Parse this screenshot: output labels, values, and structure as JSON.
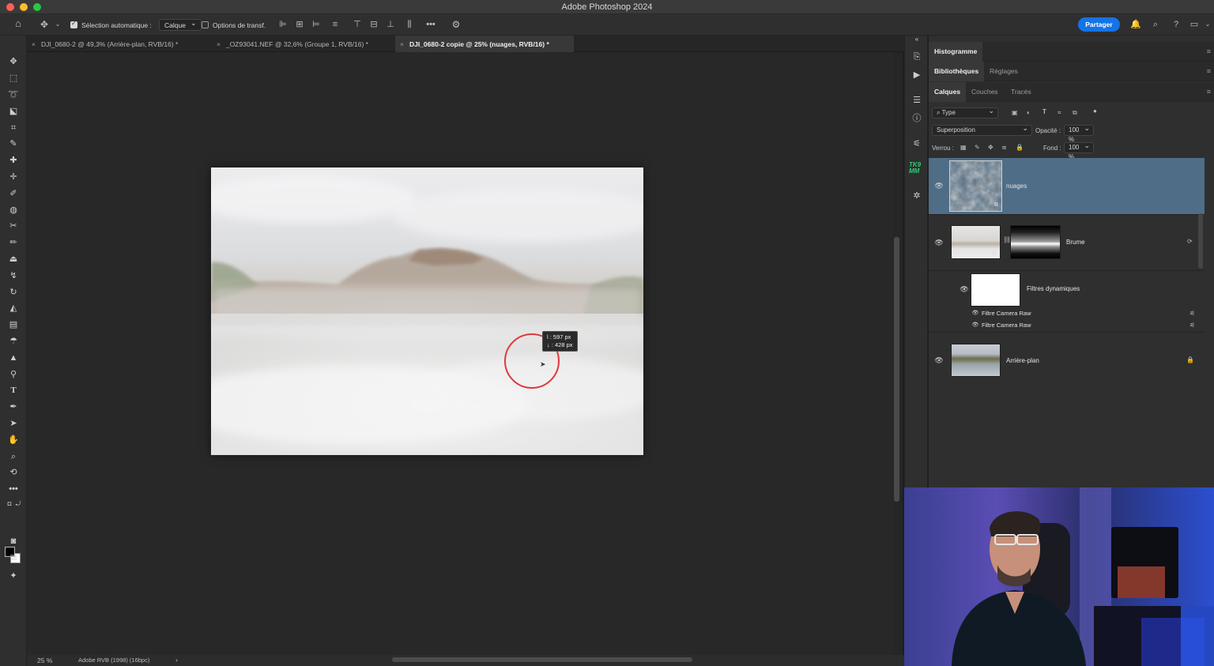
{
  "window": {
    "title": "Adobe Photoshop 2024"
  },
  "options_bar": {
    "auto_select_label": "Sélection automatique :",
    "auto_select_value": "Calque",
    "transform_options_label": "Options de transf.",
    "share_label": "Partager"
  },
  "doc_tabs": [
    {
      "label": "DJI_0680-2 @ 49,3% (Arrière-plan, RVB/16) *"
    },
    {
      "label": "_OZ93041.NEF @ 32,6% (Groupe 1, RVB/16) *"
    },
    {
      "label": "DJI_0680-2 copie @ 25% (nuages, RVB/16) *"
    }
  ],
  "canvas": {
    "cursor_readout_line1": "l : 597 px",
    "cursor_readout_line2": "↓ : 428 px"
  },
  "status_bar": {
    "zoom": "25 %",
    "color_profile": "Adobe RVB (1998) (16bpc)",
    "arrow": "›"
  },
  "panels": {
    "row1_tab": "Histogramme",
    "row2_tabs": [
      "Bibliothèques",
      "Réglages"
    ],
    "row3_tabs": [
      "Calques",
      "Couches",
      "Tracés"
    ]
  },
  "layers_panel": {
    "filter_kind": "Type",
    "blend_mode": "Superposition",
    "opacity_label": "Opacité :",
    "opacity_value": "100 %",
    "lock_label": "Verrou :",
    "fill_label": "Fond :",
    "fill_value": "100 %",
    "layers": [
      {
        "name": "nuages",
        "selected": true
      },
      {
        "name": "Brume",
        "selected": false
      },
      {
        "name": "Filtres dynamiques",
        "selected": false
      },
      {
        "name": "Filtre Camera Raw",
        "selected": false
      },
      {
        "name": "Filtre Camera Raw",
        "selected": false
      },
      {
        "name": "Arrière-plan",
        "selected": false
      }
    ]
  },
  "dock": {
    "plugin_badge": "TK9 MM"
  },
  "colors": {
    "accent_blue": "#1473e6",
    "selected_layer": "#4f6d86",
    "cursor_ring": "#e0383e"
  }
}
